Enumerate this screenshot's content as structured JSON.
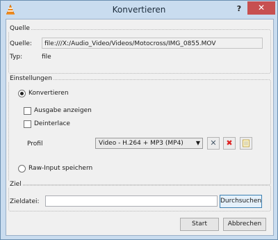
{
  "window": {
    "title": "Konvertieren",
    "help_label": "?",
    "close_label": "✕"
  },
  "source": {
    "group_title": "Quelle",
    "source_label": "Quelle:",
    "source_value": "file:///X:/Audio_Video/Videos/Motocross/IMG_0855.MOV",
    "type_label": "Typ:",
    "type_value": "file"
  },
  "settings": {
    "group_title": "Einstellungen",
    "convert_label": "Konvertieren",
    "show_output_label": "Ausgabe anzeigen",
    "deinterlace_label": "Deinterlace",
    "profile_label": "Profil",
    "profile_value": "Video - H.264 + MP3 (MP4)",
    "raw_input_label": "Raw-Input speichern"
  },
  "target": {
    "group_title": "Ziel",
    "dest_label": "Zieldatei:",
    "dest_value": "",
    "browse_label": "Durchsuchen"
  },
  "buttons": {
    "start_label": "Start",
    "cancel_label": "Abbrechen"
  }
}
